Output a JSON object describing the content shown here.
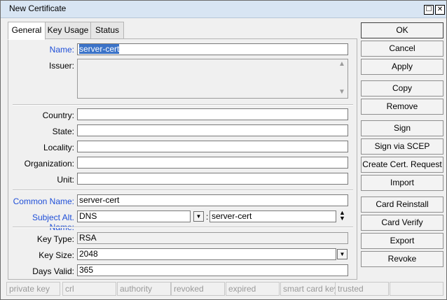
{
  "window": {
    "title": "New Certificate",
    "restore_icon": "☐",
    "close_icon": "✕"
  },
  "tabs": [
    {
      "label": "General",
      "active": true
    },
    {
      "label": "Key Usage",
      "active": false
    },
    {
      "label": "Status",
      "active": false
    }
  ],
  "form": {
    "name": {
      "label": "Name:",
      "value": "server-cert"
    },
    "issuer": {
      "label": "Issuer:",
      "value": ""
    },
    "country": {
      "label": "Country:",
      "value": ""
    },
    "state": {
      "label": "State:",
      "value": ""
    },
    "locality": {
      "label": "Locality:",
      "value": ""
    },
    "organization": {
      "label": "Organization:",
      "value": ""
    },
    "unit": {
      "label": "Unit:",
      "value": ""
    },
    "common_name": {
      "label": "Common Name:",
      "value": "server-cert"
    },
    "subject_alt_name": {
      "label": "Subject Alt. Name:",
      "type_value": "DNS",
      "separator": ":",
      "value": "server-cert"
    },
    "key_type": {
      "label": "Key Type:",
      "value": "RSA"
    },
    "key_size": {
      "label": "Key Size:",
      "value": "2048"
    },
    "days_valid": {
      "label": "Days Valid:",
      "value": "365"
    }
  },
  "buttons": {
    "ok": "OK",
    "cancel": "Cancel",
    "apply": "Apply",
    "copy": "Copy",
    "remove": "Remove",
    "sign": "Sign",
    "sign_scep": "Sign via SCEP",
    "create_request": "Create Cert. Request",
    "import": "Import",
    "card_reinstall": "Card Reinstall",
    "card_verify": "Card Verify",
    "export": "Export",
    "revoke": "Revoke"
  },
  "status_flags": [
    "private key",
    "crl",
    "authority",
    "revoked",
    "expired",
    "smart card key",
    "trusted",
    ""
  ],
  "colors": {
    "label_blue": "#1f4fd8",
    "selection": "#3b73c8",
    "titlebar": "#d8e5f3"
  }
}
